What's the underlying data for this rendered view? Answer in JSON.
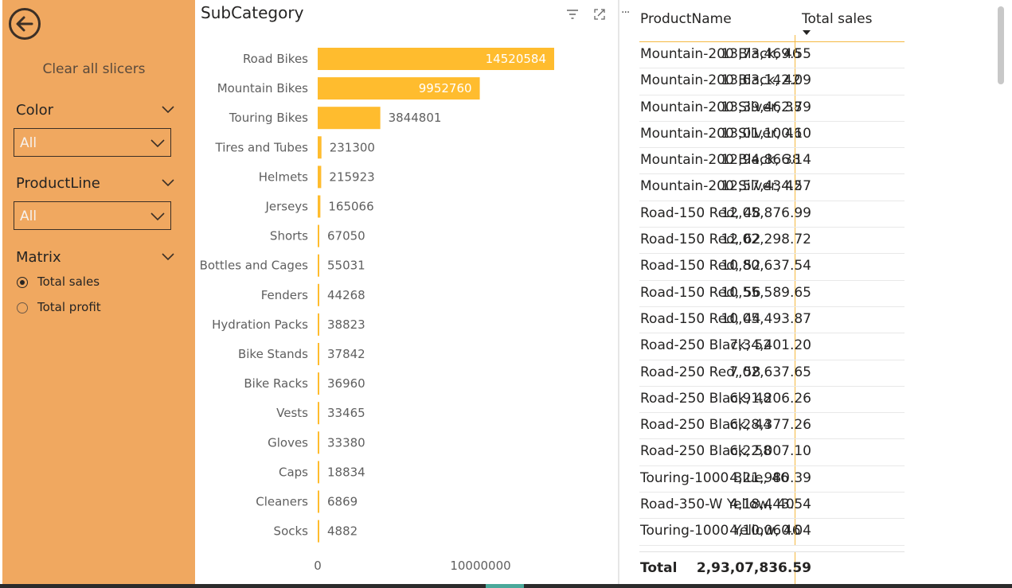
{
  "slicers": {
    "clear_label": "Clear all slicers",
    "color": {
      "title": "Color",
      "value": "All"
    },
    "product_line": {
      "title": "ProductLine",
      "value": "All"
    },
    "matrix": {
      "title": "Matrix",
      "options": [
        {
          "label": "Total sales",
          "checked": true
        },
        {
          "label": "Total profit",
          "checked": false
        }
      ]
    }
  },
  "icons": {
    "back": "arrow-left-circle-icon",
    "filter": "filter-icon",
    "focus": "focus-mode-icon",
    "more": "ellipsis-icon",
    "sort": "sort-descending-icon"
  },
  "colors": {
    "slicer_bg": "#f0a860",
    "bar": "#ffbc2e",
    "accent_line": "#f5b942"
  },
  "more_options": "···",
  "chart_data": {
    "type": "bar",
    "orientation": "horizontal",
    "title": "SubCategory",
    "categories": [
      "Road Bikes",
      "Mountain Bikes",
      "Touring Bikes",
      "Tires and Tubes",
      "Helmets",
      "Jerseys",
      "Shorts",
      "Bottles and Cages",
      "Fenders",
      "Hydration Packs",
      "Bike Stands",
      "Bike Racks",
      "Vests",
      "Gloves",
      "Caps",
      "Cleaners",
      "Socks"
    ],
    "values": [
      14520584,
      9952760,
      3844801,
      231300,
      215923,
      165066,
      67050,
      55031,
      44268,
      38823,
      37842,
      36960,
      33465,
      33380,
      18834,
      6869,
      4882
    ],
    "labels": [
      "14520584",
      "9952760",
      "3844801",
      "231300",
      "215923",
      "165066",
      "67050",
      "55031",
      "44268",
      "38823",
      "37842",
      "36960",
      "33465",
      "33380",
      "18834",
      "6869",
      "4882"
    ],
    "x_ticks": [
      0,
      10000000
    ],
    "x_tick_labels": [
      "0",
      "10000000"
    ],
    "xlim": [
      0,
      14520584
    ],
    "grid": false
  },
  "table": {
    "columns": [
      "ProductName",
      "Total sales"
    ],
    "rows": [
      [
        "Mountain-200 Black, 46",
        "13,73,469.55"
      ],
      [
        "Mountain-200 Black, 42",
        "13,63,142.09"
      ],
      [
        "Mountain-200 Silver, 38",
        "13,39,462.79"
      ],
      [
        "Mountain-200 Silver, 46",
        "13,01,100.10"
      ],
      [
        "Mountain-200 Black, 38",
        "12,94,866.14"
      ],
      [
        "Mountain-200 Silver, 42",
        "12,57,434.57"
      ],
      [
        "Road-150 Red, 48",
        "12,05,876.99"
      ],
      [
        "Road-150 Red, 62",
        "12,02,298.72"
      ],
      [
        "Road-150 Red, 52",
        "10,80,637.54"
      ],
      [
        "Road-150 Red, 56",
        "10,55,589.65"
      ],
      [
        "Road-150 Red, 44",
        "10,05,493.87"
      ],
      [
        "Road-250 Black, 52",
        "7,34,401.20"
      ],
      [
        "Road-250 Red, 58",
        "7,02,637.65"
      ],
      [
        "Road-250 Black, 48",
        "6,91,206.26"
      ],
      [
        "Road-250 Black, 44",
        "6,28,377.26"
      ],
      [
        "Road-250 Black, 58",
        "6,22,007.10"
      ],
      [
        "Touring-1000 Blue, 46",
        "4,21,980.39"
      ],
      [
        "Road-350-W Yellow, 40",
        "4,18,443.54"
      ],
      [
        "Touring-1000 Yellow, 46",
        "4,10,060.04"
      ]
    ],
    "total_label": "Total",
    "total_value": "2,93,07,836.59"
  }
}
